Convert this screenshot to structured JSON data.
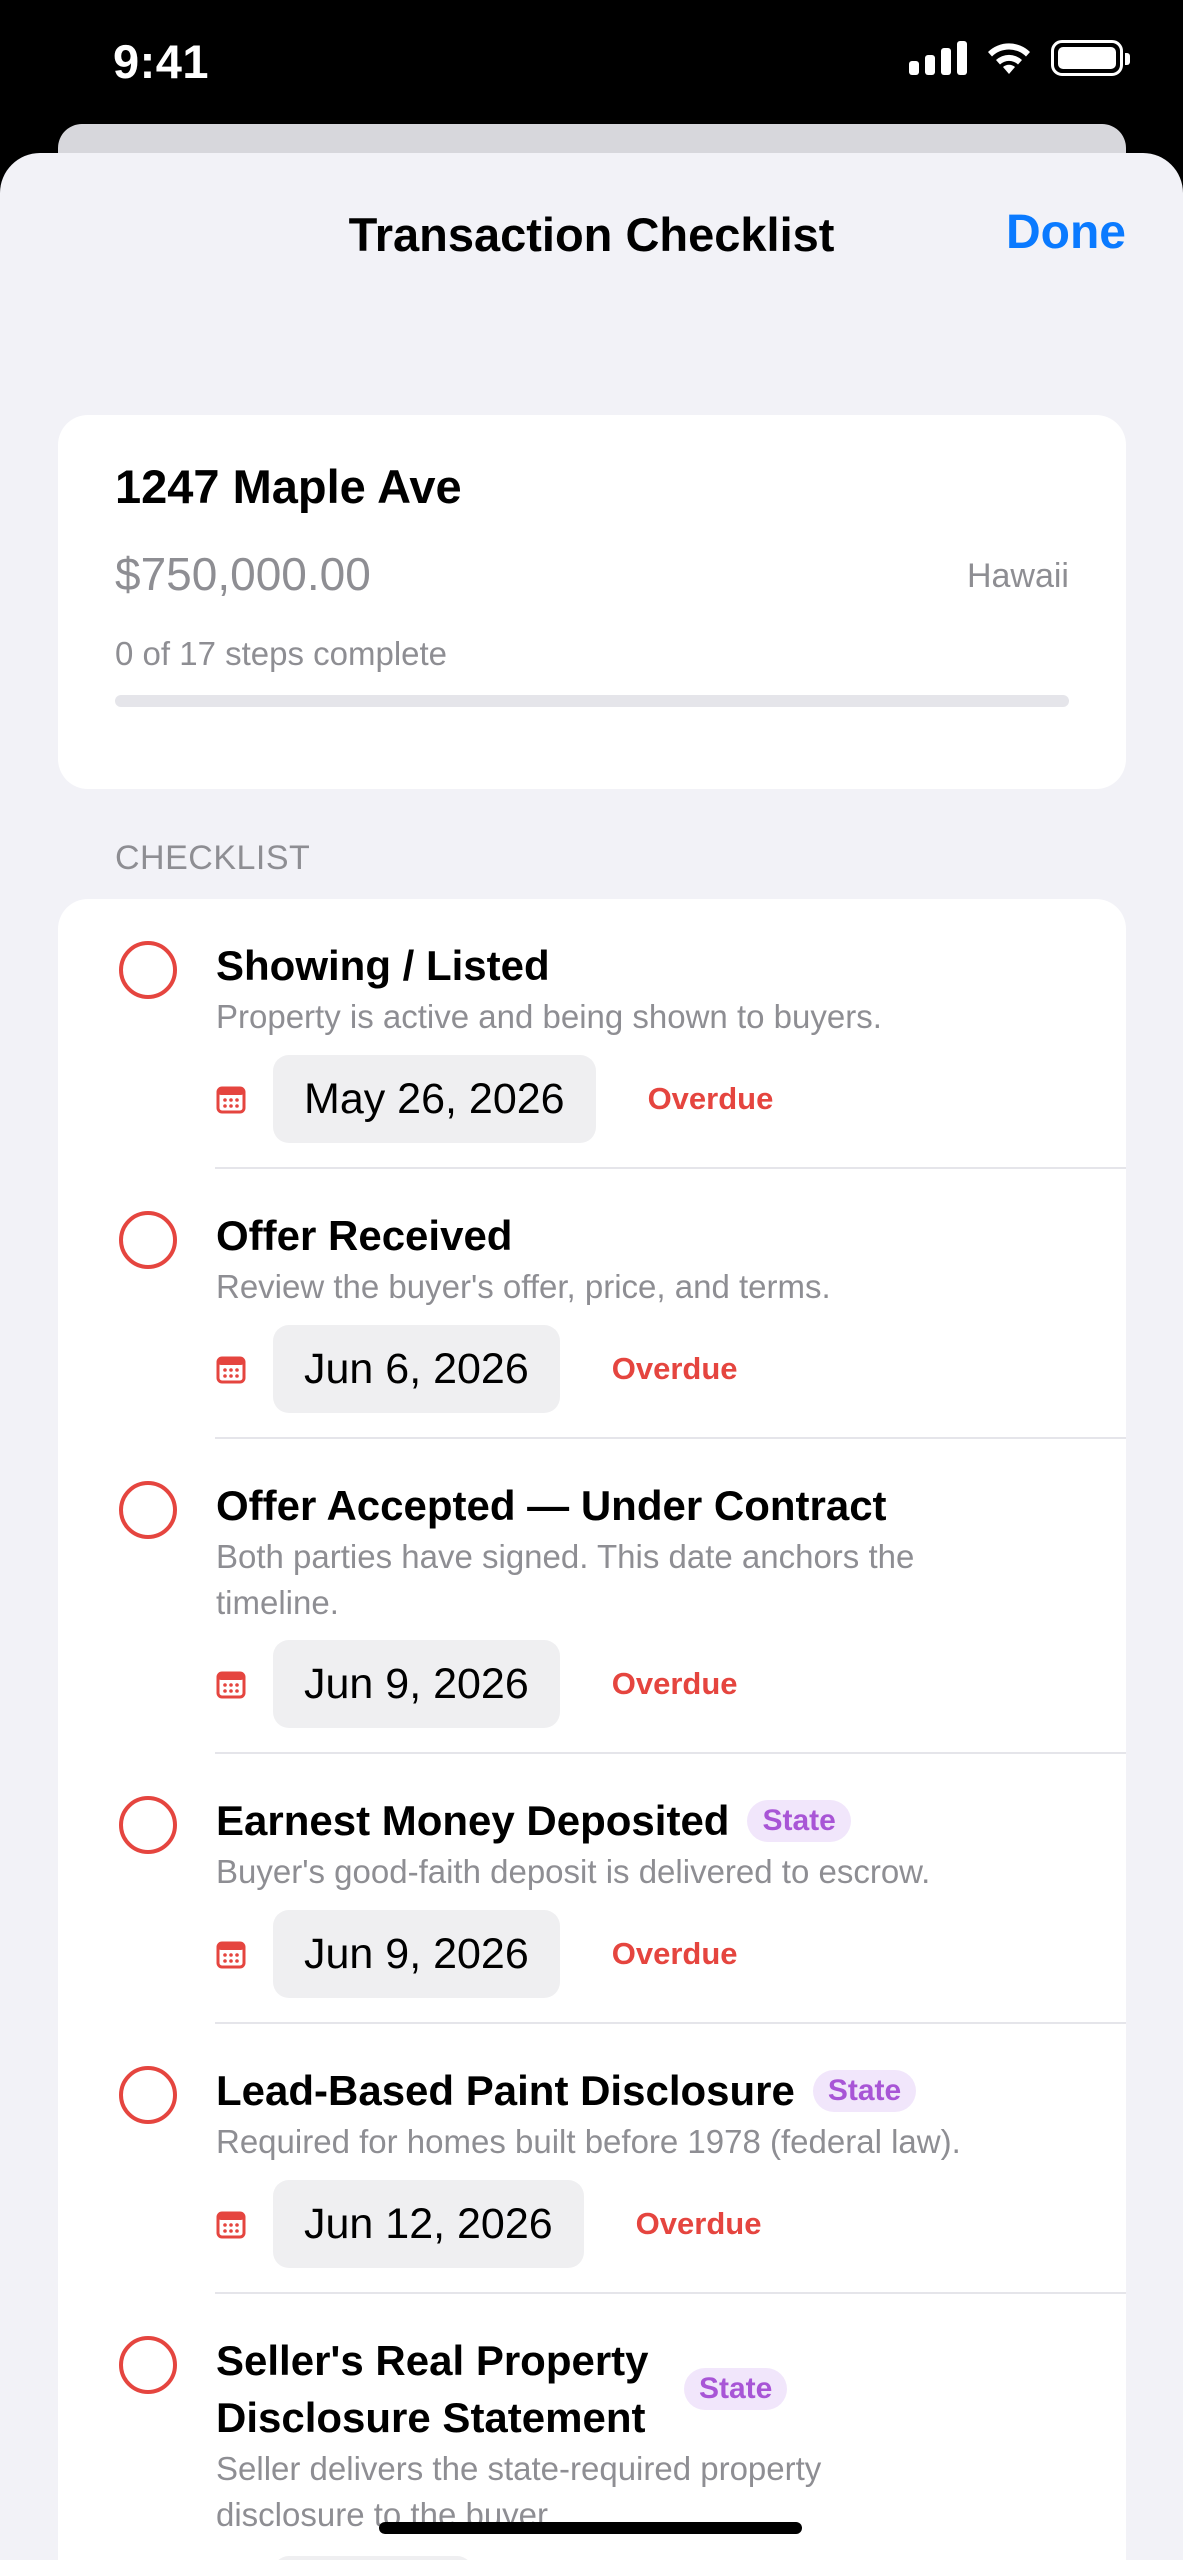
{
  "status_bar": {
    "time": "9:41"
  },
  "nav": {
    "title": "Transaction Checklist",
    "done_label": "Done"
  },
  "property": {
    "address": "1247 Maple Ave",
    "price": "$750,000.00",
    "state": "Hawaii",
    "progress_text": "0 of 17 steps complete",
    "progress_fraction": 0
  },
  "section": {
    "header": "CHECKLIST"
  },
  "steps": [
    {
      "title": "Showing / Listed",
      "badge": "",
      "description": "Property is active and being shown to buyers.",
      "date": "May 26, 2026",
      "status": "Overdue"
    },
    {
      "title": "Offer Received",
      "badge": "",
      "description": "Review the buyer's offer, price, and terms.",
      "date": "Jun 6, 2026",
      "status": "Overdue"
    },
    {
      "title": "Offer Accepted — Under Contract",
      "badge": "",
      "description": "Both parties have signed. This date anchors the timeline.",
      "date": "Jun 9, 2026",
      "status": "Overdue"
    },
    {
      "title": "Earnest Money Deposited",
      "badge": "State",
      "description": "Buyer's good-faith deposit is delivered to escrow.",
      "date": "Jun 9, 2026",
      "status": "Overdue"
    },
    {
      "title": "Lead-Based Paint Disclosure",
      "badge": "State",
      "description": "Required for homes built before 1978 (federal law).",
      "date": "Jun 12, 2026",
      "status": "Overdue"
    },
    {
      "title": "Seller's Real Property Disclosure Statement",
      "badge": "State",
      "description": "Seller delivers the state-required property disclosure to the buyer.",
      "date": "",
      "status": ""
    }
  ],
  "colors": {
    "accent": "#0a7aff",
    "overdue": "#e5453f",
    "state_badge": "#a855d6"
  },
  "icons": {
    "step_check": "empty-circle-icon",
    "date": "calendar-icon"
  }
}
